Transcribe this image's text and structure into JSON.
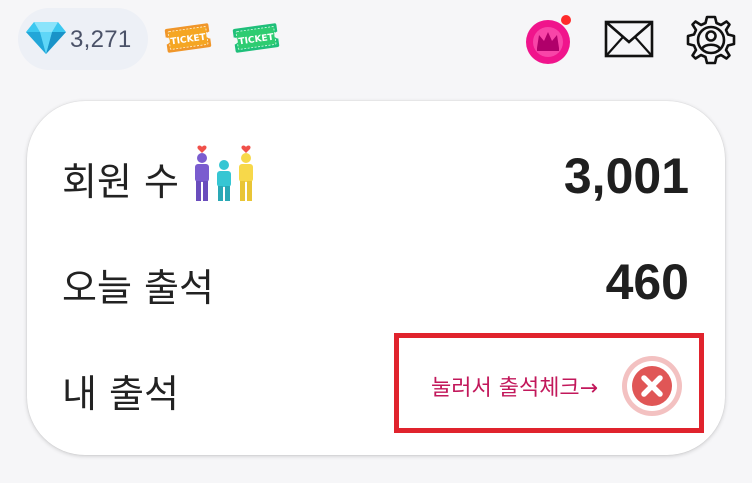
{
  "header": {
    "gem_count": "3,271",
    "ticket_label": "TICKET",
    "icons": [
      "gem-icon",
      "ticket-icon",
      "ticket-icon",
      "crown-icon",
      "mail-icon",
      "gear-icon"
    ],
    "notification_dot": true
  },
  "stats": {
    "members_label": "회원 수",
    "members_value": "3,001",
    "today_label": "오늘 출석",
    "today_value": "460",
    "mine_label": "내 출석"
  },
  "checkin": {
    "hint": "눌러서 출석체크→",
    "status_icon": "close-icon",
    "highlight_color": "#e0232d"
  },
  "colors": {
    "accent_pink": "#c2185b",
    "status_red": "#e05656",
    "ticket_orange": "#f5a623",
    "ticket_green": "#2ecc71",
    "crown_pink": "#f0148c"
  }
}
